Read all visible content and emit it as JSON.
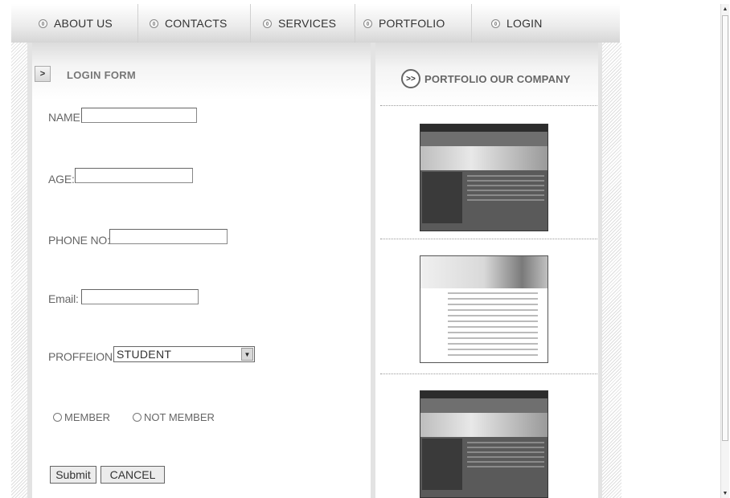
{
  "nav": {
    "items": [
      {
        "label": "ABOUT US"
      },
      {
        "label": "CONTACTS"
      },
      {
        "label": "SERVICES"
      },
      {
        "label": "PORTFOLIO"
      },
      {
        "label": "LOGIN"
      }
    ]
  },
  "login": {
    "title": "LOGIN FORM",
    "name_label": "NAME",
    "age_label": "AGE:",
    "phone_label": "PHONE NO:",
    "email_label": "Email:",
    "profession_label": "PROFFEION:",
    "profession_value": "STUDENT",
    "member_label": "MEMBER",
    "not_member_label": "NOT MEMBER",
    "submit_label": "Submit",
    "cancel_label": "CANCEL"
  },
  "portfolio": {
    "title": "PORTFOLIO OUR COMPANY",
    "icon": "double-chevron-right-icon"
  },
  "colors": {
    "background": "#ffffff",
    "nav_text": "#333333",
    "label_text": "#666666",
    "panel_border": "#e3e3e3"
  }
}
